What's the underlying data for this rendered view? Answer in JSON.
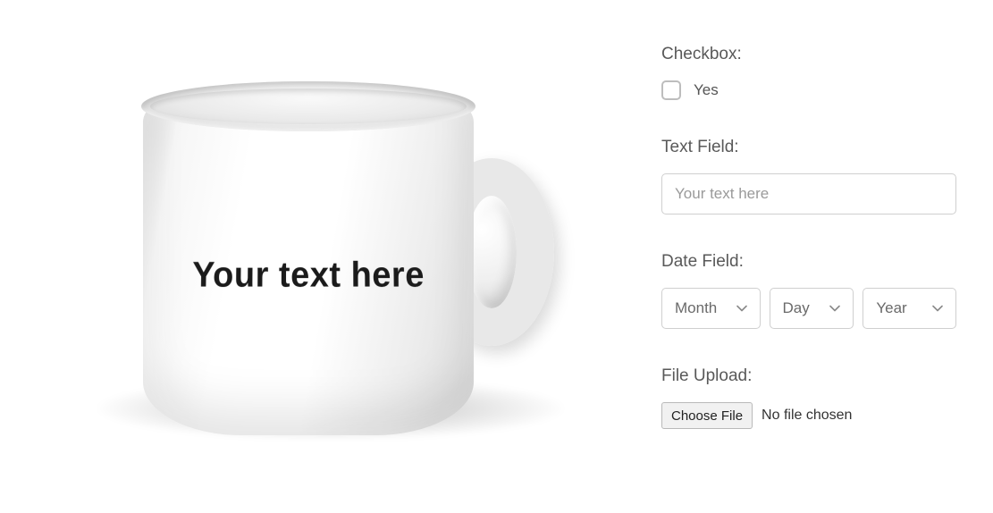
{
  "product": {
    "preview_text": "Your text here"
  },
  "form": {
    "checkbox": {
      "label": "Checkbox:",
      "option_label": "Yes",
      "checked": false
    },
    "text_field": {
      "label": "Text Field:",
      "placeholder": "Your text here",
      "value": ""
    },
    "date_field": {
      "label": "Date Field:",
      "month_placeholder": "Month",
      "day_placeholder": "Day",
      "year_placeholder": "Year"
    },
    "file_upload": {
      "label": "File Upload:",
      "button_label": "Choose File",
      "status_text": "No file chosen"
    }
  }
}
